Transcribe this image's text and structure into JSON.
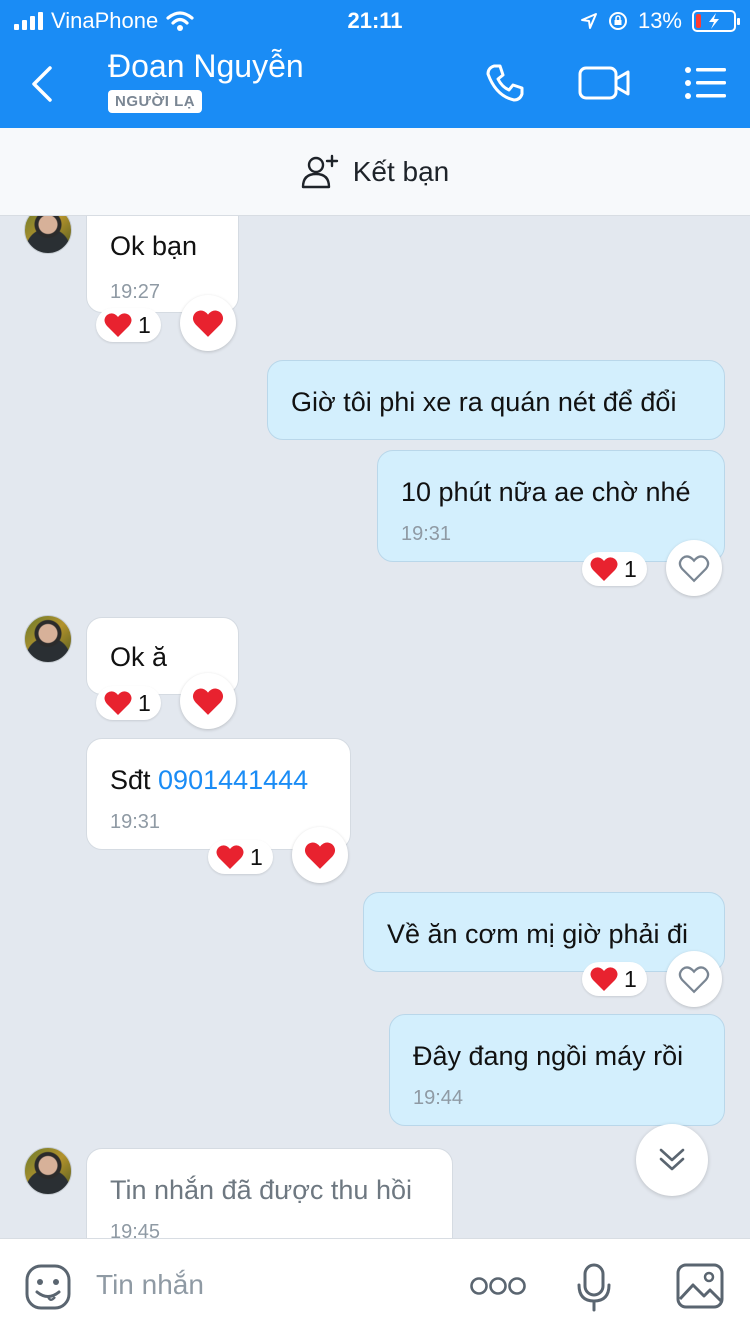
{
  "status_bar": {
    "carrier": "VinaPhone",
    "time": "21:11",
    "battery": "13%",
    "battery_level": 0.13
  },
  "header": {
    "contact_name": "Đoan Nguyễn",
    "badge": "NGƯỜI LẠ"
  },
  "icons": {
    "back": "chevron-left-icon",
    "call": "phone-icon",
    "video": "video-camera-icon",
    "menu": "menu-list-icon"
  },
  "add_friend": {
    "label": "Kết bạn"
  },
  "messages": [
    {
      "side": "in",
      "text": "Ok bạn",
      "time": "19:27",
      "reaction_count": "1"
    },
    {
      "side": "out",
      "text": "Giờ tôi phi xe ra quán nét để đổi"
    },
    {
      "side": "out",
      "text": "10 phút nữa ae chờ nhé",
      "time": "19:31",
      "reaction_count": "1"
    },
    {
      "side": "in",
      "text": "Ok ă",
      "reaction_count": "1"
    },
    {
      "side": "in",
      "text_prefix": "Sđt ",
      "phone": "0901441444",
      "time": "19:31",
      "reaction_count": "1"
    },
    {
      "side": "out",
      "text": "Về ăn cơm mị giờ phải đi",
      "reaction_count": "1"
    },
    {
      "side": "out",
      "text": "Đây đang ngồi máy rồi",
      "time": "19:44"
    },
    {
      "side": "in",
      "text": "Tin nhắn đã được thu hồi",
      "time": "19:45"
    }
  ],
  "composer": {
    "placeholder": "Tin nhắn"
  },
  "colors": {
    "accent": "#1a8cf5",
    "outgoing_bubble": "#d3effd",
    "heart": "#e8222f"
  }
}
